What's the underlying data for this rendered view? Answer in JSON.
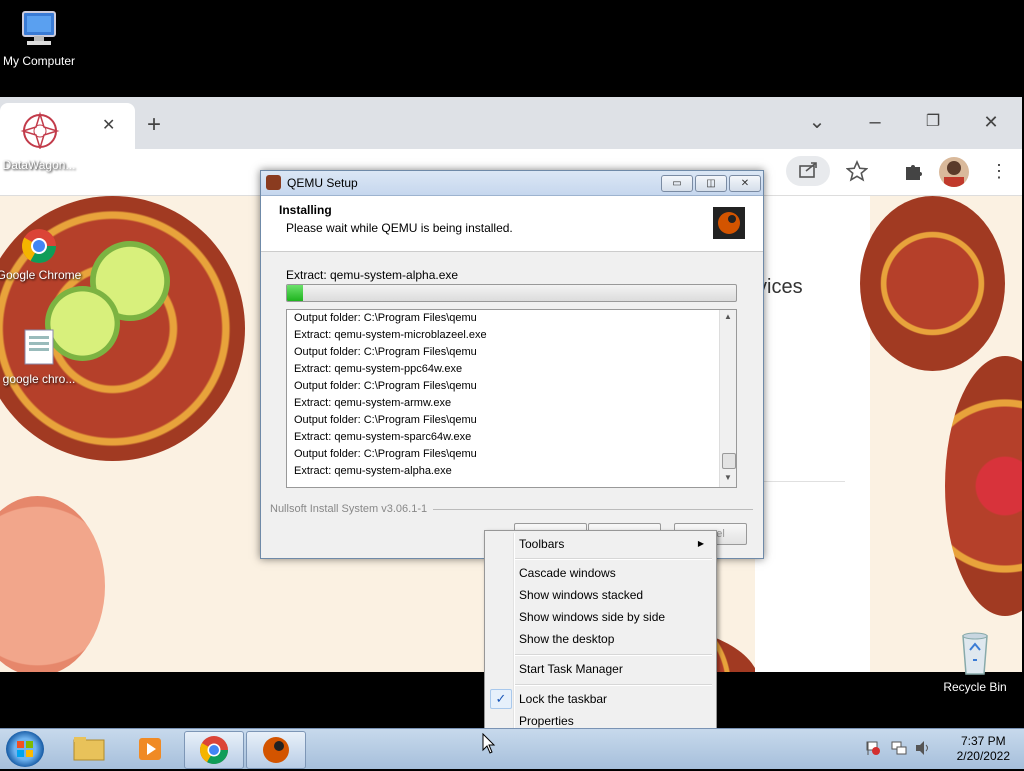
{
  "desktop": {
    "icons": [
      {
        "label": "My Computer"
      },
      {
        "label": "DataWagon..."
      },
      {
        "label": "Google Chrome"
      },
      {
        "label": "google chro..."
      },
      {
        "label": "Recycle Bin"
      }
    ]
  },
  "chrome": {
    "page_partial_text": "vices",
    "window_buttons": {
      "dropdown": "⌄",
      "minimize": "–",
      "restore": "❐",
      "close": "✕"
    },
    "new_tab": "+",
    "tab_close": "✕"
  },
  "qemu": {
    "title": "QEMU Setup",
    "header_title": "Installing",
    "header_subtitle": "Please wait while QEMU is being installed.",
    "current_action": "Extract: qemu-system-alpha.exe",
    "progress": 0.035,
    "log": [
      "Output folder: C:\\Program Files\\qemu",
      "Extract: qemu-system-microblazeel.exe",
      "Output folder: C:\\Program Files\\qemu",
      "Extract: qemu-system-ppc64w.exe",
      "Output folder: C:\\Program Files\\qemu",
      "Extract: qemu-system-armw.exe",
      "Output folder: C:\\Program Files\\qemu",
      "Extract: qemu-system-sparc64w.exe",
      "Output folder: C:\\Program Files\\qemu",
      "Extract: qemu-system-alpha.exe"
    ],
    "branding": "Nullsoft Install System v3.06.1-1",
    "cancel_fragment": "el"
  },
  "context_menu": {
    "toolbars": "Toolbars",
    "cascade": "Cascade windows",
    "stacked": "Show windows stacked",
    "side_by_side": "Show windows side by side",
    "show_desktop": "Show the desktop",
    "task_manager": "Start Task Manager",
    "lock_taskbar": "Lock the taskbar",
    "properties": "Properties"
  },
  "taskbar": {
    "time": "7:37 PM",
    "date": "2/20/2022"
  }
}
